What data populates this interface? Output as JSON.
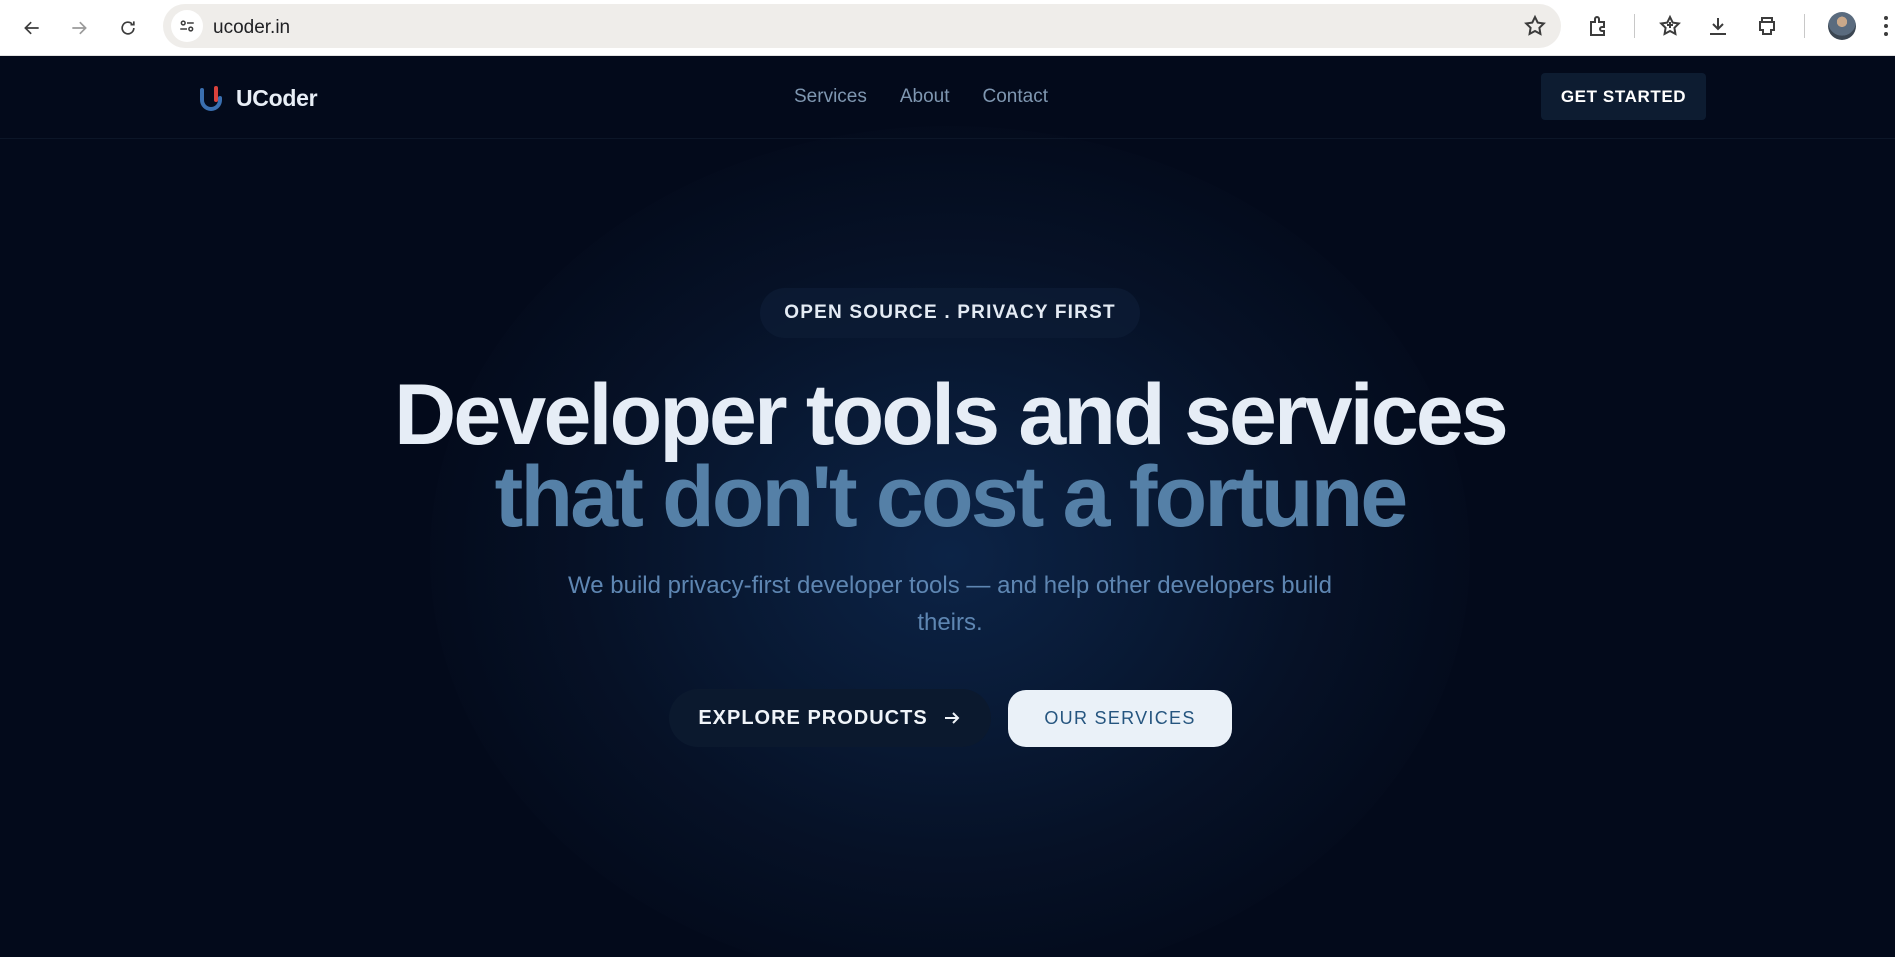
{
  "browser": {
    "url": "ucoder.in",
    "icons": [
      "back-icon",
      "forward-icon",
      "reload-icon",
      "site-info-icon",
      "bookmark-star-icon",
      "extensions-icon",
      "bookmarks-icon",
      "download-icon",
      "print-icon",
      "profile-avatar",
      "menu-icon"
    ]
  },
  "header": {
    "brand": "UCoder",
    "nav": [
      "Services",
      "About",
      "Contact"
    ],
    "cta": "GET STARTED"
  },
  "hero": {
    "eyebrow": "OPEN SOURCE . PRIVACY FIRST",
    "headline_line1": "Developer tools and services",
    "headline_line2": "that don't cost a fortune",
    "subtitle": "We build privacy-first developer tools — and help other developers build theirs.",
    "primary_button": "EXPLORE PRODUCTS",
    "secondary_button": "OUR SERVICES"
  },
  "colors": {
    "page_background": "#030a1b",
    "headline_primary": "#e6edf6",
    "headline_accent": "#5580a7",
    "subtitle": "#5e86b2",
    "button_dark": "#0b192e",
    "button_light": "#eaf1f8"
  }
}
